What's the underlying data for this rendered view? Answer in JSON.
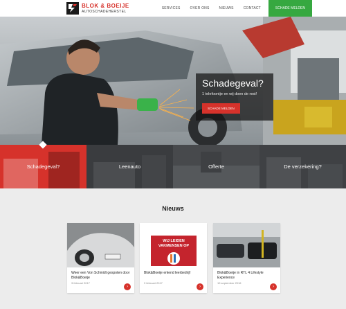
{
  "header": {
    "logo_name": "BLOK & BOEIJE",
    "logo_sub": "AUTOSCHADEHERSTEL",
    "nav": [
      "SERVICES",
      "OVER ONS",
      "NIEUWS",
      "CONTACT"
    ],
    "cta": "SCHADE MELDEN"
  },
  "hero": {
    "title": "Schadegeval?",
    "subtitle": "1 telefoontje en wij doen de rest!",
    "button": "SCHADE MELDEN"
  },
  "tiles": [
    {
      "label": "Schadegeval?"
    },
    {
      "label": "Leenauto"
    },
    {
      "label": "Offerte"
    },
    {
      "label": "De verzekering?"
    }
  ],
  "news": {
    "title": "Nieuws",
    "cards": [
      {
        "title": "Weer een Von Schmidt gespoten door Blok&Boeije",
        "date": "3 februari 2017"
      },
      {
        "title": "Blok&Boeije erkend leerbedrijf",
        "date": "3 februari 2017",
        "badge": "WIJ LEIDEN VAKMENSEN OP"
      },
      {
        "title": "Blok&Boeije in RTL 4 Lifestyle Experience",
        "date": "19 september 2016"
      }
    ]
  },
  "colors": {
    "accent": "#d6322b",
    "cta": "#36a840",
    "dark": "#3a3c3f"
  }
}
